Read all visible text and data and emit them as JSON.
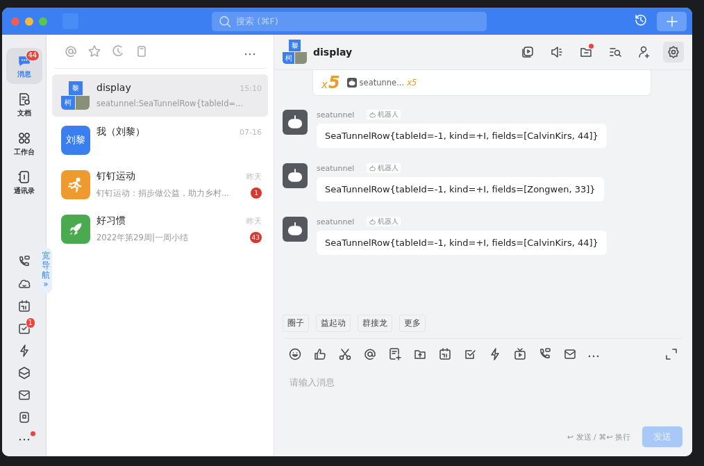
{
  "title_bar": {
    "search_placeholder": "搜索 (⌘F)"
  },
  "nav": {
    "items": [
      {
        "kind": "chat",
        "label": "消息",
        "selected": true,
        "badge": "44"
      },
      {
        "kind": "doc",
        "label": "文档",
        "selected": false
      },
      {
        "kind": "grid",
        "label": "工作台",
        "selected": false
      },
      {
        "kind": "contacts",
        "label": "通讯录",
        "selected": false
      }
    ],
    "tools": [
      {
        "kind": "phone"
      },
      {
        "kind": "cloud"
      },
      {
        "kind": "calendar"
      },
      {
        "kind": "todo",
        "badge": "1"
      },
      {
        "kind": "flash"
      },
      {
        "kind": "cube"
      },
      {
        "kind": "mail"
      },
      {
        "kind": "note"
      },
      {
        "kind": "more",
        "dot": true
      }
    ],
    "wide_nav": {
      "label": "宽导航",
      "arrow": "»"
    }
  },
  "chat_list": {
    "conversations": [
      {
        "name": "display",
        "time": "15:10",
        "preview": "seatunnel:SeaTunnelRow{tableId=...",
        "selected": true,
        "avatar": {
          "kind": "group",
          "tiles": [
            "黎",
            "柯"
          ]
        }
      },
      {
        "name": "我（刘黎）",
        "time": "07-16",
        "selected": false,
        "avatar": {
          "kind": "text",
          "text": "刘黎",
          "color": "#3a7ef0"
        }
      },
      {
        "name": "钉钉运动",
        "time": "昨天",
        "preview": "钉钉运动：捐步做公益，助力乡村...",
        "badge": "1",
        "selected": false,
        "avatar": {
          "kind": "runner",
          "color": "#ee9a2c"
        }
      },
      {
        "name": "好习惯",
        "time": "昨天",
        "preview": "2022年第29周|一周小结",
        "badge": "43",
        "selected": false,
        "avatar": {
          "kind": "rocket",
          "color": "#4aaa4f"
        }
      }
    ]
  },
  "chat": {
    "avatar": {
      "tiles": [
        "黎",
        "柯"
      ]
    },
    "title": "display",
    "header_actions": [
      {
        "kind": "video",
        "dot": false,
        "selected": false
      },
      {
        "kind": "speaker",
        "dot": false,
        "selected": false
      },
      {
        "kind": "folder",
        "dot": true,
        "selected": false
      },
      {
        "kind": "search",
        "dot": false,
        "selected": false
      },
      {
        "kind": "add-person",
        "dot": false,
        "selected": false
      },
      {
        "kind": "settings",
        "dot": false,
        "selected": true
      }
    ],
    "card": {
      "prefix": "x",
      "count": "5",
      "sender": "seatunne...",
      "sender_count": "x5"
    },
    "messages": [
      {
        "sender": "seatunnel",
        "tag": "机器人",
        "text": "SeaTunnelRow{tableId=-1, kind=+I, fields=[CalvinKirs, 44]}"
      },
      {
        "sender": "seatunnel",
        "tag": "机器人",
        "text": "SeaTunnelRow{tableId=-1, kind=+I, fields=[Zongwen, 33]}"
      },
      {
        "sender": "seatunnel",
        "tag": "机器人",
        "text": "SeaTunnelRow{tableId=-1, kind=+I, fields=[CalvinKirs, 44]}"
      }
    ],
    "quick_actions": [
      "圈子",
      "益起动",
      "群接龙",
      "更多"
    ],
    "composer": {
      "placeholder": "请输入消息",
      "hint": "↩ 发送 / ⌘↩ 换行",
      "send_button": {
        "label": "发送",
        "disabled": true
      }
    }
  }
}
